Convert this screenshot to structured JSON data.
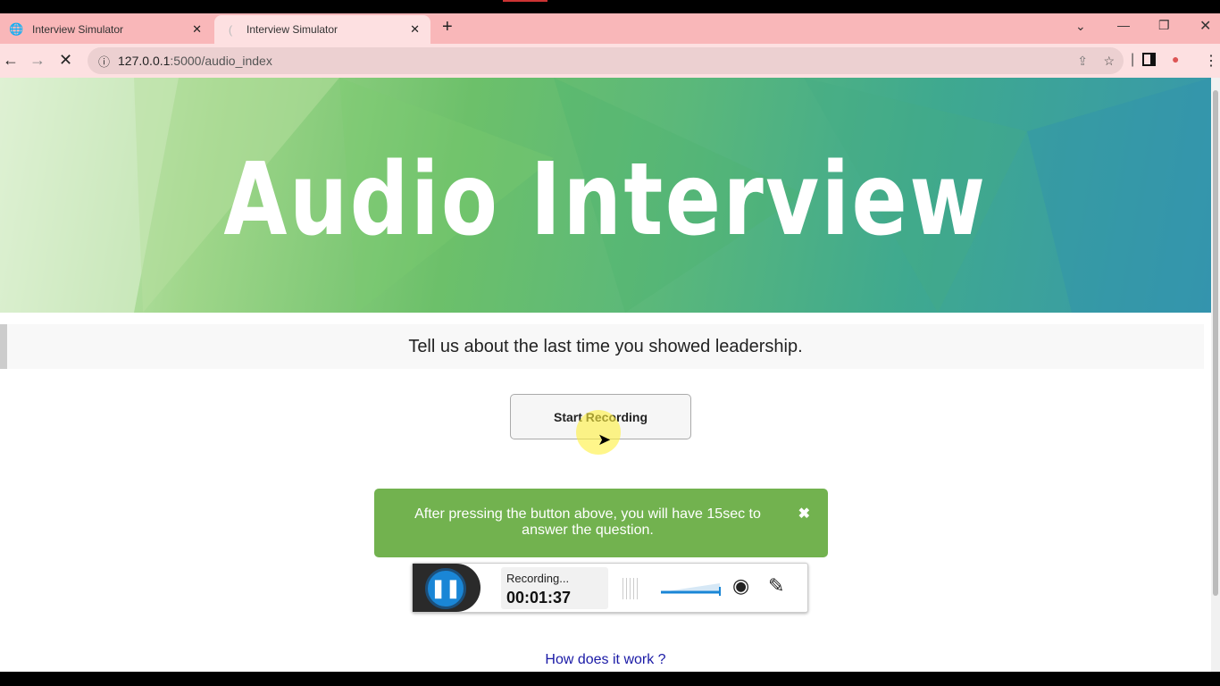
{
  "browser": {
    "tabs": [
      {
        "title": "Interview Simulator",
        "icon": "globe-icon",
        "active": false
      },
      {
        "title": "Interview Simulator",
        "icon": "loading-spinner-icon",
        "active": true
      }
    ],
    "url_host": "127.0.0.1",
    "url_path": ":5000/audio_index"
  },
  "page": {
    "banner_title": "Audio Interview",
    "question": "Tell us about the last time you showed leadership.",
    "start_button": "Start Recording",
    "alert": {
      "message": "After pressing the button above, you will have 15sec to answer the question.",
      "close": "✖"
    },
    "recorder": {
      "status": "Recording...",
      "time": "00:01:37"
    },
    "help_link": "How does it work ?"
  },
  "colors": {
    "tabstrip": "#f9b7b9",
    "alert": "#72b24f",
    "pause": "#1a86d6",
    "link": "#1a1aa6"
  }
}
